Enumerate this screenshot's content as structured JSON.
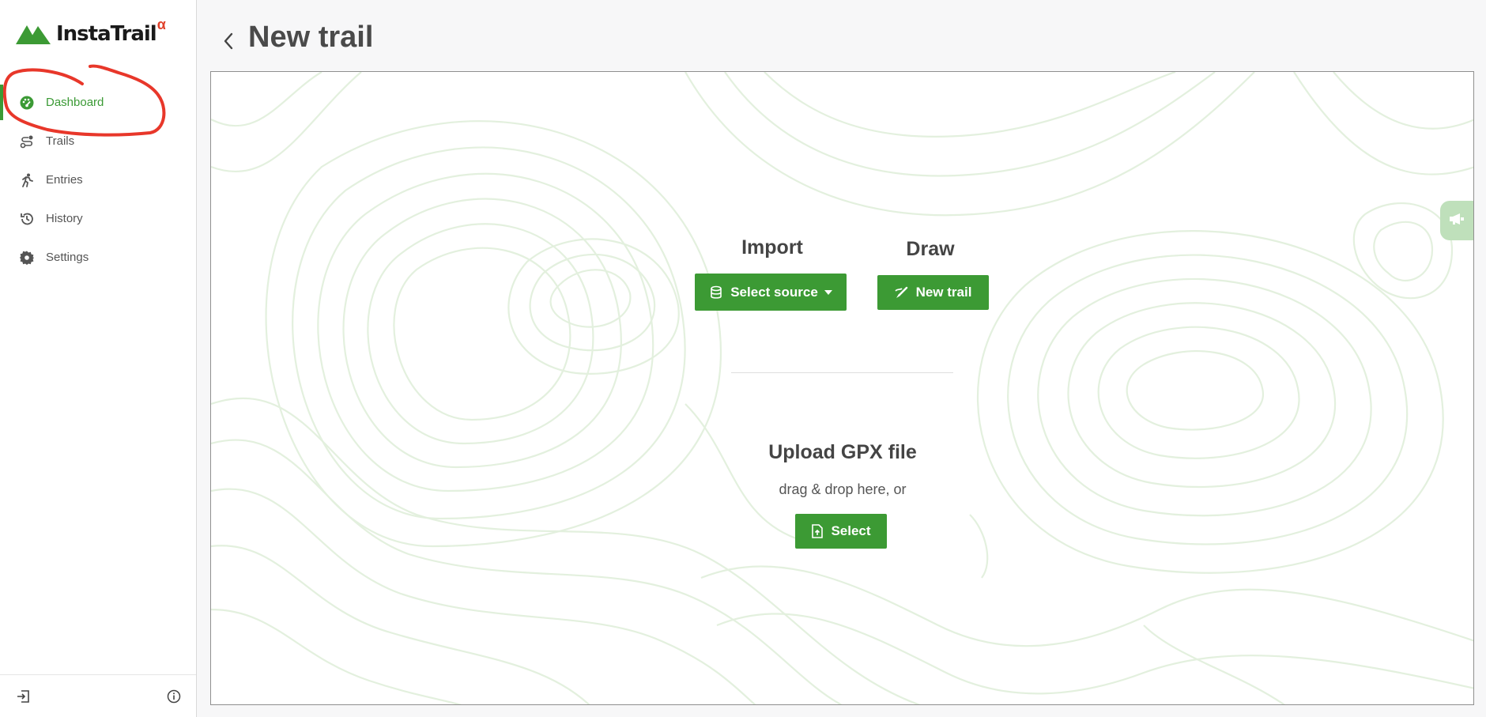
{
  "app": {
    "logo_text": "InstaTrail",
    "logo_sup": "α",
    "brand_color": "#3c9a34",
    "alert_color": "#e0402a"
  },
  "sidebar": {
    "items": [
      {
        "label": "Dashboard",
        "icon": "dashboard-icon",
        "active": true
      },
      {
        "label": "Trails",
        "icon": "trails-icon",
        "active": false
      },
      {
        "label": "Entries",
        "icon": "runner-icon",
        "active": false
      },
      {
        "label": "History",
        "icon": "history-icon",
        "active": false
      },
      {
        "label": "Settings",
        "icon": "gear-icon",
        "active": false
      }
    ],
    "footer": {
      "left_icon": "logout-icon",
      "right_icon": "info-icon"
    }
  },
  "header": {
    "title": "New trail",
    "back_icon": "chevron-left-icon"
  },
  "import": {
    "title": "Import",
    "button_label": "Select source",
    "button_icon": "database-icon"
  },
  "draw": {
    "title": "Draw",
    "button_label": "New trail",
    "button_icon": "draw-icon"
  },
  "upload": {
    "title": "Upload GPX file",
    "subtitle": "drag & drop here, or",
    "button_label": "Select",
    "button_icon": "file-upload-icon"
  },
  "feedback": {
    "icon": "megaphone-icon"
  }
}
